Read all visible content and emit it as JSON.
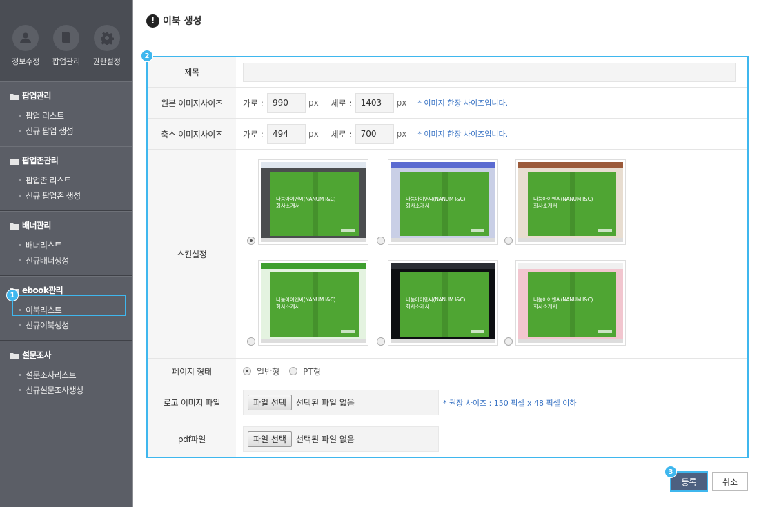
{
  "sidebar": {
    "top_icons": [
      {
        "label": "정보수정",
        "icon": "user-icon"
      },
      {
        "label": "팝업관리",
        "icon": "book-icon"
      },
      {
        "label": "권한설정",
        "icon": "gear-icon"
      }
    ],
    "groups": [
      {
        "title": "팝업관리",
        "items": [
          "팝업 리스트",
          "신규 팝업 생성"
        ]
      },
      {
        "title": "팝업존관리",
        "items": [
          "팝업존 리스트",
          "신규 팝업존 생성"
        ]
      },
      {
        "title": "배너관리",
        "items": [
          "배너리스트",
          "신규배너생성"
        ]
      },
      {
        "title": "ebook관리",
        "items": [
          "이북리스트",
          "신규이북생성"
        ]
      },
      {
        "title": "설문조사",
        "items": [
          "설문조사리스트",
          "신규설문조사생성"
        ]
      }
    ]
  },
  "badges": {
    "b1": "1",
    "b2": "2",
    "b3": "3"
  },
  "page": {
    "title": "이북 생성",
    "title_icon": "!"
  },
  "form": {
    "title_label": "제목",
    "orig_label": "원본 이미지사이즈",
    "orig": {
      "w_label": "가로 :",
      "w_value": "990",
      "w_unit": "px",
      "h_label": "세로 :",
      "h_value": "1403",
      "h_unit": "px",
      "note": "* 이미지 한장 사이즈입니다."
    },
    "thumb_label": "축소 이미지사이즈",
    "thumb": {
      "w_label": "가로 :",
      "w_value": "494",
      "w_unit": "px",
      "h_label": "세로 :",
      "h_value": "700",
      "h_unit": "px",
      "note": "* 이미지 한장 사이즈입니다."
    },
    "skin_label": "스킨설정",
    "skin_title_line1": "나눔아이앤씨(NANUM I&C)",
    "skin_title_line2": "회사소개서",
    "skins": [
      {
        "frame": "#4b4d4f",
        "bar": "#dfe6ee",
        "selected": true
      },
      {
        "frame": "#c9cfe6",
        "bar": "#5b6bd1",
        "selected": false
      },
      {
        "frame": "#e8ddd0",
        "bar": "#9b5a3a",
        "selected": false
      },
      {
        "frame": "#e4f3e0",
        "bar": "#3f9f2f",
        "selected": false
      },
      {
        "frame": "#0d0f12",
        "bar": "#2a2d33",
        "selected": false
      },
      {
        "frame": "#f2c6cf",
        "bar": "#f0f0f0",
        "selected": false
      }
    ],
    "ptype_label": "페이지 형태",
    "ptype_options": [
      "일반형",
      "PT형"
    ],
    "logo_label": "로고 이미지 파일",
    "file_button": "파일 선택",
    "file_none": "선택된 파일 없음",
    "logo_note": "* 권장 사이즈 : 150 픽셀 x 48 픽셀 이하",
    "pdf_label": "pdf파일"
  },
  "buttons": {
    "register": "등록",
    "cancel": "취소"
  }
}
